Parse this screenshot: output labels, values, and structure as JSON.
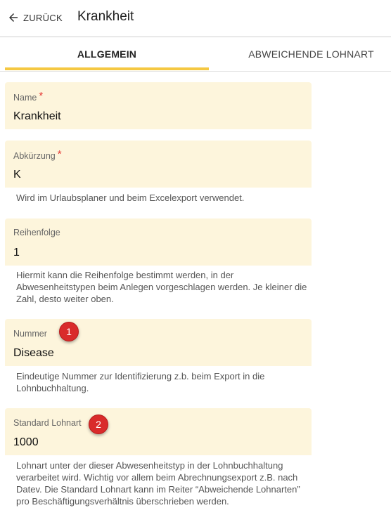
{
  "header": {
    "back_label": "ZURÜCK",
    "title": "Krankheit"
  },
  "tabs": [
    {
      "label": "ALLGEMEIN",
      "active": true
    },
    {
      "label": "ABWEICHENDE LOHNART",
      "active": false
    }
  ],
  "fields": {
    "name": {
      "label": "Name",
      "required": "*",
      "value": "Krankheit"
    },
    "abkuerzung": {
      "label": "Abkürzung",
      "required": "*",
      "value": "K",
      "hint": "Wird im Urlaubsplaner und beim Excelexport verwendet."
    },
    "reihenfolge": {
      "label": "Reihenfolge",
      "value": "1",
      "hint": "Hiermit kann die Reihenfolge bestimmt werden, in der Abwesenheitstypen beim Anlegen vorgeschlagen werden. Je kleiner die Zahl, desto weiter oben."
    },
    "nummer": {
      "label": "Nummer",
      "value": "Disease",
      "hint": "Eindeutige Nummer zur Identifizierung z.b. beim Export in die Lohnbuchhaltung."
    },
    "standard_lohnart": {
      "label": "Standard Lohnart",
      "value": "1000",
      "hint": "Lohnart unter der dieser Abwesenheitstyp in der Lohnbuchhaltung verarbeitet wird. Wichtig vor allem beim Abrechnungsexport z.B. nach Datev. Die Standard Lohnart kann im Reiter “Abweichende Lohnarten” pro Beschäftigungsverhältnis überschrieben werden."
    }
  },
  "annotations": [
    "1",
    "2"
  ],
  "colors": {
    "accent": "#f5c842",
    "field_bg": "#fdf5dc",
    "required": "#e53935",
    "badge": "#d92b2b"
  }
}
